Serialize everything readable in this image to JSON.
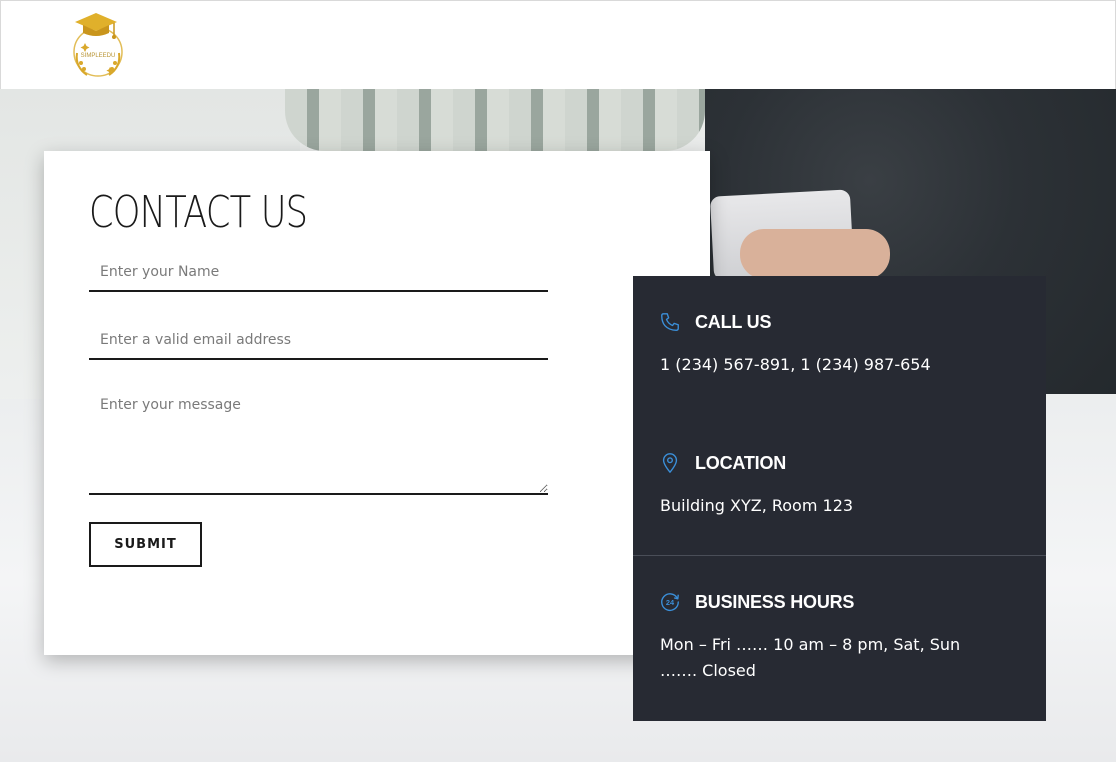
{
  "brand": {
    "logo_text": "SIMPLEEDU"
  },
  "contact_form": {
    "title": "CONTACT US",
    "name_placeholder": "Enter your Name",
    "email_placeholder": "Enter a valid email address",
    "message_placeholder": "Enter your message",
    "submit_label": "SUBMIT"
  },
  "info": {
    "call": {
      "icon": "phone-icon",
      "heading": "CALL US",
      "text": "1 (234) 567-891, 1 (234) 987-654"
    },
    "location": {
      "icon": "location-pin-icon",
      "heading": "LOCATION",
      "text": "Building XYZ, Room 123"
    },
    "hours": {
      "icon": "clock-24-icon",
      "heading": "BUSINESS HOURS",
      "text": "Mon – Fri …… 10 am – 8 pm, Sat, Sun ……. Closed"
    }
  },
  "colors": {
    "panel_bg": "#272a33",
    "icon_accent": "#3b8fd9",
    "logo_gold": "#d9a82b"
  }
}
